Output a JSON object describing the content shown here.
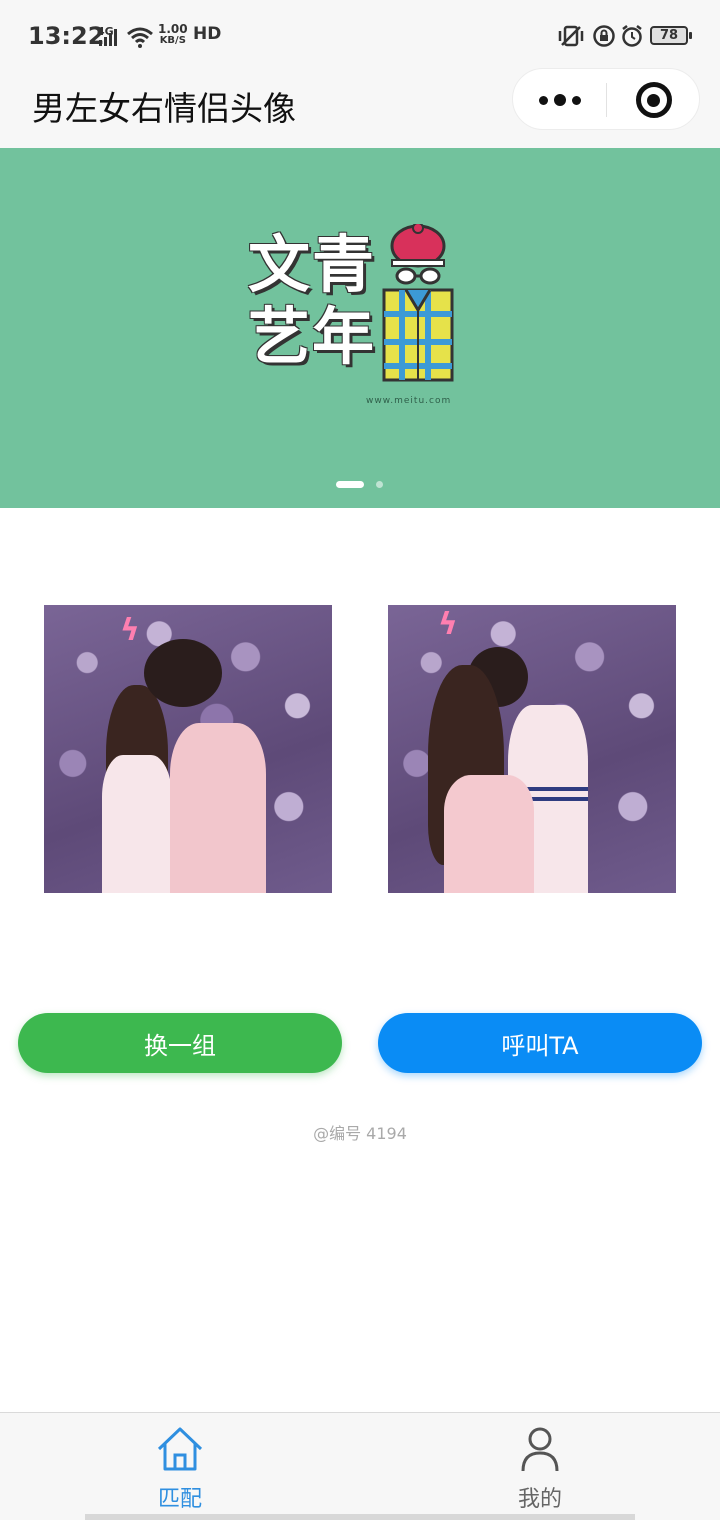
{
  "status_bar": {
    "time": "13:22",
    "network": "4G",
    "speed_value": "1.00",
    "speed_unit": "KB/S",
    "hd": "HD",
    "battery": "78"
  },
  "nav": {
    "title": "男左女右情侣头像"
  },
  "banner": {
    "line1": "文青",
    "line2": "艺年",
    "url": "www.meitu.com",
    "pages": 2,
    "active_page": 1
  },
  "actions": {
    "shuffle_label": "换一组",
    "call_label": "呼叫TA"
  },
  "serial": "@编号 4194",
  "tabs": [
    {
      "label": "匹配",
      "icon": "home-icon",
      "active": true
    },
    {
      "label": "我的",
      "icon": "person-icon",
      "active": false
    }
  ],
  "colors": {
    "banner_bg": "#72c29d",
    "shuffle_button": "#3db84f",
    "call_button": "#0a8cf5",
    "active_tab": "#2f8fe0"
  }
}
